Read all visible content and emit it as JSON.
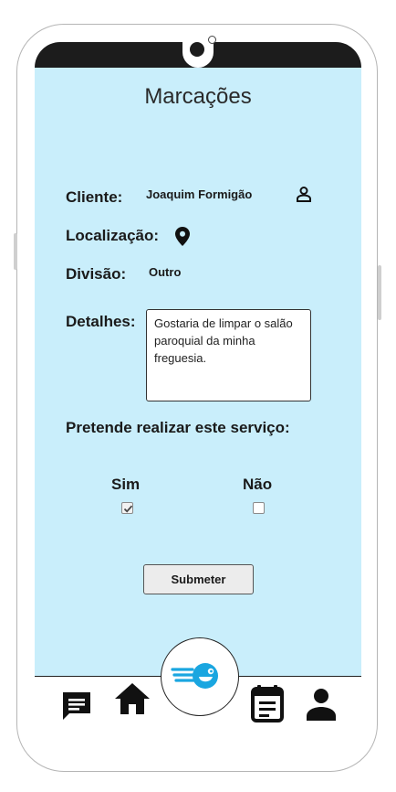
{
  "header": {
    "title": "Marcações"
  },
  "form": {
    "client_label": "Cliente:",
    "client_value": "Joaquim Formigão",
    "location_label": "Localização:",
    "division_label": "Divisão:",
    "division_value": "Outro",
    "details_label": "Detalhes:",
    "details_value": "Gostaria de limpar o salão paroquial da minha freguesia.",
    "question": "Pretende realizar este serviço:",
    "options": [
      {
        "label": "Sim",
        "checked": true
      },
      {
        "label": "Não",
        "checked": false
      }
    ],
    "submit_label": "Submeter"
  },
  "icons": {
    "client": "person-outline-icon",
    "location": "location-pin-icon"
  },
  "nav": {
    "items": [
      "chat-icon",
      "home-icon",
      "cleaning-logo-icon",
      "calendar-icon",
      "profile-icon"
    ]
  },
  "colors": {
    "screen_background": "#c9eefb",
    "logo_blue": "#1aa6e0"
  }
}
